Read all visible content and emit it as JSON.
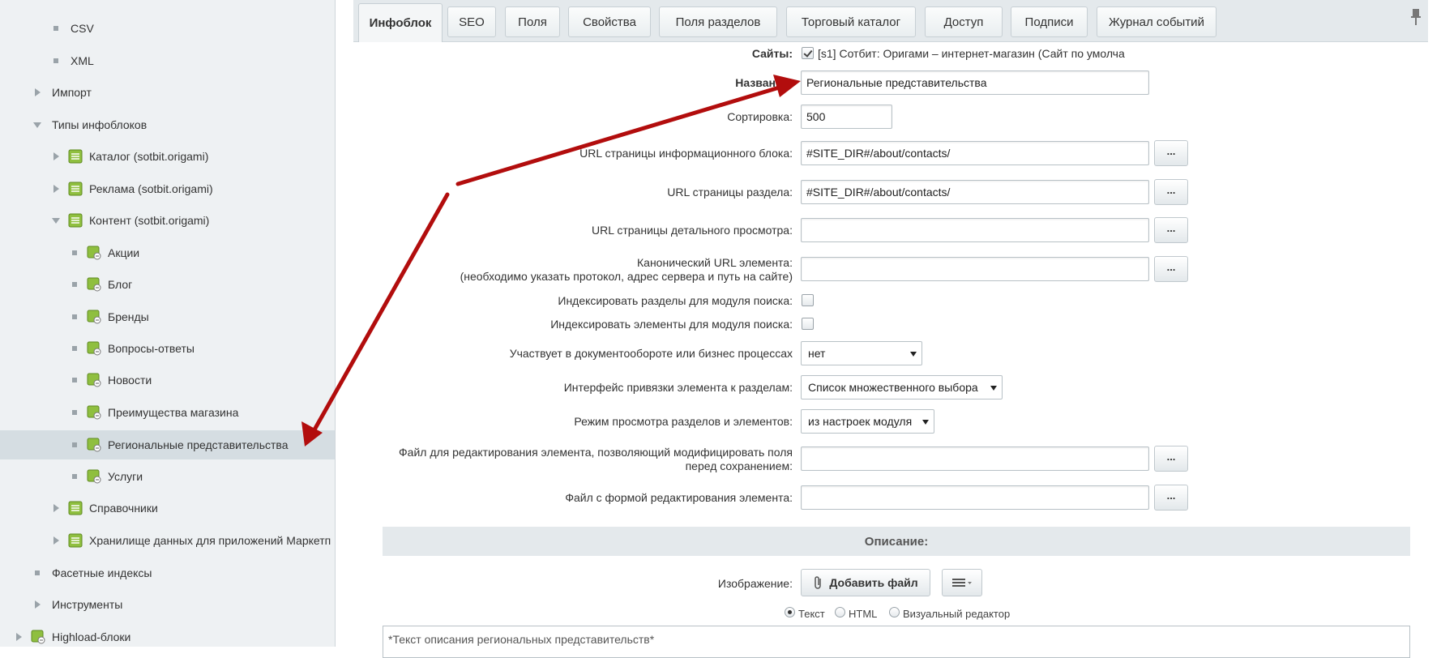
{
  "sidebar": {
    "items": [
      {
        "label": "CSV",
        "kind": "bullet",
        "level": 2
      },
      {
        "label": "XML",
        "kind": "bullet",
        "level": 2
      },
      {
        "label": "Импорт",
        "kind": "collapsed",
        "level": 1
      },
      {
        "label": "Типы инфоблоков",
        "kind": "expanded",
        "level": 1
      },
      {
        "label": "Каталог (sotbit.origami)",
        "kind": "collapsed-icon",
        "level": 2
      },
      {
        "label": "Реклама (sotbit.origami)",
        "kind": "collapsed-icon",
        "level": 2
      },
      {
        "label": "Контент (sotbit.origami)",
        "kind": "expanded-icon",
        "level": 2
      },
      {
        "label": "Акции",
        "kind": "bullet-icon",
        "level": 3
      },
      {
        "label": "Блог",
        "kind": "bullet-icon",
        "level": 3
      },
      {
        "label": "Бренды",
        "kind": "bullet-icon",
        "level": 3
      },
      {
        "label": "Вопросы-ответы",
        "kind": "bullet-icon",
        "level": 3
      },
      {
        "label": "Новости",
        "kind": "bullet-icon",
        "level": 3
      },
      {
        "label": "Преимущества магазина",
        "kind": "bullet-icon",
        "level": 3
      },
      {
        "label": "Региональные представительства",
        "kind": "bullet-icon",
        "level": 3,
        "selected": true
      },
      {
        "label": "Услуги",
        "kind": "bullet-icon",
        "level": 3
      },
      {
        "label": "Справочники",
        "kind": "collapsed-icon",
        "level": 2
      },
      {
        "label": "Хранилище данных для приложений Маркетп",
        "kind": "collapsed-icon",
        "level": 2
      },
      {
        "label": "Фасетные индексы",
        "kind": "bullet",
        "level": 1
      },
      {
        "label": "Инструменты",
        "kind": "collapsed",
        "level": 1
      },
      {
        "label": "Highload-блоки",
        "kind": "collapsed-icon",
        "level": 0
      }
    ]
  },
  "tabs": [
    {
      "label": "Инфоблок",
      "active": true
    },
    {
      "label": "SEO"
    },
    {
      "label": "Поля"
    },
    {
      "label": "Свойства"
    },
    {
      "label": "Поля разделов"
    },
    {
      "label": "Торговый каталог"
    },
    {
      "label": "Доступ"
    },
    {
      "label": "Подписи"
    },
    {
      "label": "Журнал событий"
    }
  ],
  "form": {
    "sites": {
      "label": "Сайты:",
      "value": "[s1] Сотбит: Оригами – интернет-магазин (Сайт по умолча",
      "checked": true
    },
    "name": {
      "label": "Название:",
      "value": "Региональные представительства"
    },
    "sort": {
      "label": "Сортировка:",
      "value": "500"
    },
    "list_url": {
      "label": "URL страницы информационного блока:",
      "value": "#SITE_DIR#/about/contacts/"
    },
    "section_url": {
      "label": "URL страницы раздела:",
      "value": "#SITE_DIR#/about/contacts/"
    },
    "detail_url": {
      "label": "URL страницы детального просмотра:",
      "value": ""
    },
    "canonical_url": {
      "label_line1": "Канонический URL элемента:",
      "label_line2": "(необходимо указать протокол, адрес сервера и путь на сайте)",
      "value": ""
    },
    "index_sections": {
      "label": "Индексировать разделы для модуля поиска:",
      "checked": false
    },
    "index_elements": {
      "label": "Индексировать элементы для модуля поиска:",
      "checked": false
    },
    "workflow": {
      "label": "Участвует в документообороте или бизнес процессах",
      "value": "нет"
    },
    "section_ui": {
      "label": "Интерфейс привязки элемента к разделам:",
      "value": "Список множественного выбора"
    },
    "list_mode": {
      "label": "Режим просмотра разделов и элементов:",
      "value": "из настроек модуля"
    },
    "edit_file": {
      "label_line1": "Файл для редактирования элемента, позволяющий модифицировать поля",
      "label_line2": "перед сохранением:",
      "value": ""
    },
    "edit_form_file": {
      "label": "Файл с формой редактирования элемента:",
      "value": ""
    },
    "dots_label": "..."
  },
  "description_section": {
    "header": "Описание:",
    "image_label": "Изображение:",
    "add_file_label": "Добавить файл",
    "radios": [
      {
        "label": "Текст",
        "checked": true
      },
      {
        "label": "HTML",
        "checked": false
      },
      {
        "label": "Визуальный редактор",
        "checked": false
      }
    ],
    "placeholder_text": "*Текст описания региональных представительств*"
  },
  "colors": {
    "annotation_arrow": "#b20d0d",
    "sidebar_bg": "#eef1f3",
    "sidebar_selected": "#d5dde2",
    "tree_icon_green": "#8fbf3f"
  }
}
